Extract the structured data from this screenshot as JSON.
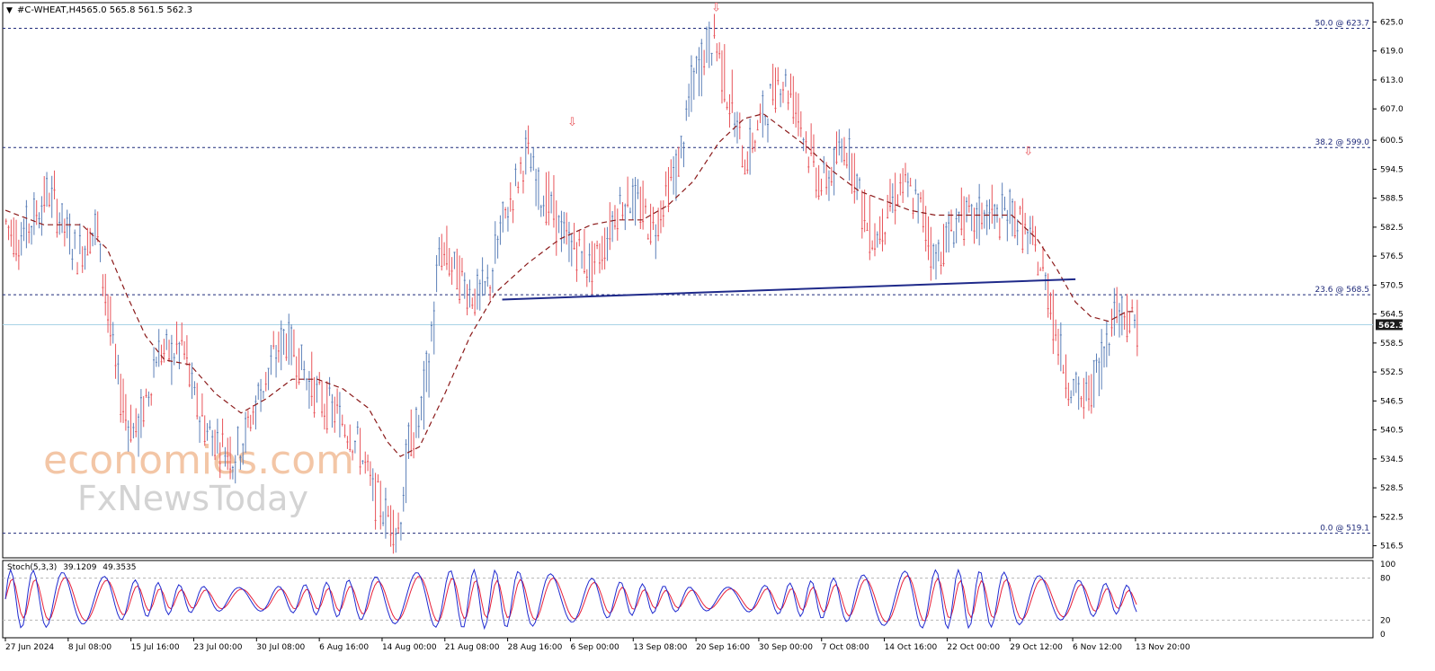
{
  "header": {
    "symbol_label": "#C-WHEAT,H4",
    "ohlc_text": "565.0 565.8 561.5 562.3"
  },
  "watermark": {
    "line1": "economies.com",
    "line2": "FxNewsToday"
  },
  "colors": {
    "bull_candle": "#5b7fb8",
    "bear_candle": "#e8545a",
    "moving_average": "#8b1a1a",
    "trendline": "#1f2a8a",
    "fib_line": "#1f2a7a",
    "current_price_line": "#a9d3e6",
    "price_badge": "#1a1a1a",
    "stoch_main": "#1f2ad0",
    "stoch_signal": "#e8203a",
    "arrow_marker": "#e8545a",
    "watermark_orange": "#f3c6a6",
    "watermark_gray": "#d3d3d3"
  },
  "chart_data": [
    {
      "type": "candlestick",
      "title": "#C-WHEAT,H4",
      "timeframe": "H4",
      "current_price": 562.3,
      "current_price_label": "562.3",
      "ylim": [
        514.0,
        629.0
      ],
      "y_ticks": [
        625.0,
        619.0,
        613.0,
        607.0,
        600.5,
        594.5,
        588.5,
        582.5,
        576.5,
        570.5,
        564.5,
        558.5,
        552.5,
        546.5,
        540.5,
        534.5,
        528.5,
        522.5,
        516.5
      ],
      "y_tick_labels": [
        "625.0",
        "619.0",
        "613.0",
        "607.0",
        "600.5",
        "594.5",
        "588.5",
        "582.5",
        "576.5",
        "570.5",
        "564.5",
        "558.5",
        "552.5",
        "546.5",
        "540.5",
        "534.5",
        "528.5",
        "522.5",
        "516.5"
      ],
      "x_tick_labels": [
        "27 Jun 2024",
        "8 Jul 08:00",
        "15 Jul 16:00",
        "23 Jul 00:00",
        "30 Jul 08:00",
        "6 Aug 16:00",
        "14 Aug 00:00",
        "21 Aug 08:00",
        "28 Aug 16:00",
        "6 Sep 00:00",
        "13 Sep 08:00",
        "20 Sep 16:00",
        "30 Sep 00:00",
        "7 Oct 08:00",
        "14 Oct 16:00",
        "22 Oct 00:00",
        "29 Oct 12:00",
        "6 Nov 12:00",
        "13 Nov 20:00"
      ],
      "fib_levels": [
        {
          "label": "50.0 @ 623.7",
          "value": 623.7
        },
        {
          "label": "38.2 @ 599.0",
          "value": 599.0
        },
        {
          "label": "23.6 @ 568.5",
          "value": 568.5
        },
        {
          "label": "0.0 @ 519.1",
          "value": 519.1
        }
      ],
      "price_path": [
        [
          0,
          584
        ],
        [
          10,
          580
        ],
        [
          20,
          583
        ],
        [
          35,
          590
        ],
        [
          48,
          582
        ],
        [
          58,
          577
        ],
        [
          66,
          580
        ],
        [
          72,
          583
        ],
        [
          80,
          568
        ],
        [
          88,
          552
        ],
        [
          96,
          543
        ],
        [
          104,
          540
        ],
        [
          112,
          547
        ],
        [
          120,
          557
        ],
        [
          130,
          556
        ],
        [
          140,
          558
        ],
        [
          150,
          546
        ],
        [
          160,
          540
        ],
        [
          170,
          538
        ],
        [
          180,
          535
        ],
        [
          190,
          540
        ],
        [
          200,
          548
        ],
        [
          210,
          554
        ],
        [
          220,
          560
        ],
        [
          230,
          556
        ],
        [
          240,
          550
        ],
        [
          250,
          546
        ],
        [
          260,
          544
        ],
        [
          270,
          541
        ],
        [
          280,
          536
        ],
        [
          290,
          527
        ],
        [
          300,
          523
        ],
        [
          310,
          520
        ],
        [
          318,
          538
        ],
        [
          326,
          542
        ],
        [
          334,
          556
        ],
        [
          342,
          578
        ],
        [
          350,
          575
        ],
        [
          360,
          571
        ],
        [
          370,
          568
        ],
        [
          380,
          570
        ],
        [
          390,
          582
        ],
        [
          400,
          590
        ],
        [
          410,
          598
        ],
        [
          420,
          590
        ],
        [
          430,
          586
        ],
        [
          440,
          580
        ],
        [
          450,
          578
        ],
        [
          460,
          574
        ],
        [
          470,
          578
        ],
        [
          480,
          586
        ],
        [
          490,
          589
        ],
        [
          500,
          586
        ],
        [
          510,
          582
        ],
        [
          520,
          590
        ],
        [
          530,
          596
        ],
        [
          540,
          612
        ],
        [
          550,
          619
        ],
        [
          558,
          622
        ],
        [
          566,
          612
        ],
        [
          574,
          604
        ],
        [
          582,
          596
        ],
        [
          590,
          602
        ],
        [
          600,
          608
        ],
        [
          610,
          614
        ],
        [
          618,
          610
        ],
        [
          626,
          604
        ],
        [
          634,
          596
        ],
        [
          642,
          591
        ],
        [
          650,
          594
        ],
        [
          660,
          600
        ],
        [
          668,
          594
        ],
        [
          676,
          583
        ],
        [
          684,
          580
        ],
        [
          694,
          586
        ],
        [
          704,
          591
        ],
        [
          712,
          589
        ],
        [
          720,
          586
        ],
        [
          730,
          576
        ],
        [
          740,
          580
        ],
        [
          750,
          585
        ],
        [
          760,
          583
        ],
        [
          770,
          586
        ],
        [
          780,
          584
        ],
        [
          790,
          586
        ],
        [
          800,
          582
        ],
        [
          810,
          577
        ],
        [
          820,
          569
        ],
        [
          826,
          560
        ],
        [
          834,
          552
        ],
        [
          842,
          548
        ],
        [
          848,
          546
        ],
        [
          856,
          551
        ],
        [
          864,
          558
        ],
        [
          870,
          565
        ],
        [
          878,
          566
        ],
        [
          884,
          563
        ],
        [
          888,
          562.3
        ]
      ],
      "moving_average": [
        [
          0,
          586
        ],
        [
          30,
          583
        ],
        [
          60,
          583
        ],
        [
          80,
          578
        ],
        [
          96,
          568
        ],
        [
          110,
          560
        ],
        [
          125,
          555
        ],
        [
          145,
          554
        ],
        [
          165,
          548
        ],
        [
          185,
          544
        ],
        [
          205,
          547
        ],
        [
          225,
          551
        ],
        [
          245,
          551
        ],
        [
          265,
          549
        ],
        [
          285,
          545
        ],
        [
          300,
          538
        ],
        [
          310,
          535
        ],
        [
          325,
          537
        ],
        [
          345,
          548
        ],
        [
          365,
          560
        ],
        [
          385,
          569
        ],
        [
          410,
          575
        ],
        [
          435,
          580
        ],
        [
          460,
          583
        ],
        [
          480,
          584
        ],
        [
          500,
          584
        ],
        [
          520,
          587
        ],
        [
          540,
          592
        ],
        [
          560,
          600
        ],
        [
          580,
          605
        ],
        [
          595,
          606
        ],
        [
          610,
          603
        ],
        [
          630,
          599
        ],
        [
          650,
          594
        ],
        [
          670,
          590
        ],
        [
          690,
          588
        ],
        [
          710,
          586
        ],
        [
          730,
          585
        ],
        [
          760,
          585
        ],
        [
          790,
          585
        ],
        [
          810,
          580
        ],
        [
          825,
          574
        ],
        [
          840,
          567
        ],
        [
          852,
          564
        ],
        [
          866,
          563
        ],
        [
          880,
          565
        ],
        [
          888,
          565
        ]
      ],
      "trendline": {
        "x": [
          390,
          840
        ],
        "y": [
          567.5,
          571.7
        ]
      },
      "down_arrows": [
        {
          "x": 445,
          "y": 603.5
        },
        {
          "x": 558,
          "y": 627.2
        },
        {
          "x": 803,
          "y": 597.5
        }
      ],
      "x_range": [
        0,
        1070
      ]
    },
    {
      "type": "line",
      "title": "Stoch(5,3,3) 39.1209 49.3535",
      "header_label": "Stoch(5,3,3)",
      "main_value": "39.1209",
      "signal_value": "49.3535",
      "ylim": [
        0,
        100
      ],
      "y_ticks": [
        100,
        80,
        20,
        0
      ],
      "y_tick_labels": [
        "100",
        "80",
        "20",
        "0"
      ],
      "levels": [
        80,
        20
      ],
      "series": []
    }
  ]
}
